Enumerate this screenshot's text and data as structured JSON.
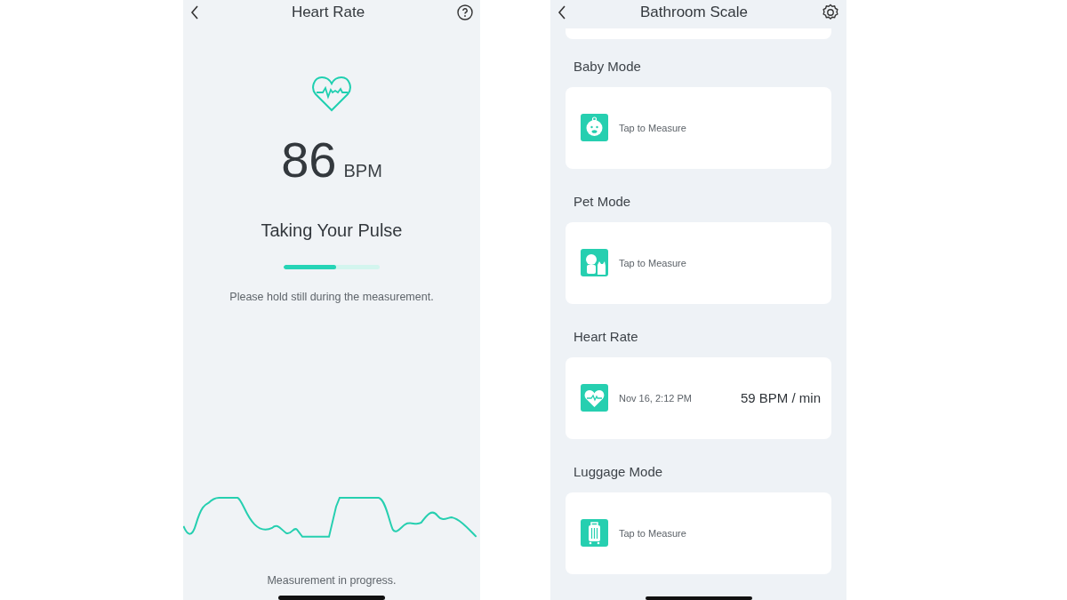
{
  "left_screen": {
    "title": "Heart Rate",
    "reading": "86",
    "unit": "BPM",
    "status_title": "Taking Your Pulse",
    "progress": {
      "level": 0.55
    },
    "hint": "Please hold still during the measurement.",
    "footer": "Measurement in progress."
  },
  "right_screen": {
    "title": "Bathroom Scale",
    "sections": [
      {
        "title": "Baby Mode",
        "kind": "baby",
        "text": "Tap to Measure"
      },
      {
        "title": "Pet Mode",
        "kind": "pet",
        "text": "Tap to Measure"
      },
      {
        "title": "Heart Rate",
        "kind": "heart",
        "text": "Nov 16, 2:12 PM",
        "value": "59 BPM / min"
      },
      {
        "title": "Luggage Mode",
        "kind": "luggage",
        "text": "Tap to Measure"
      }
    ]
  }
}
